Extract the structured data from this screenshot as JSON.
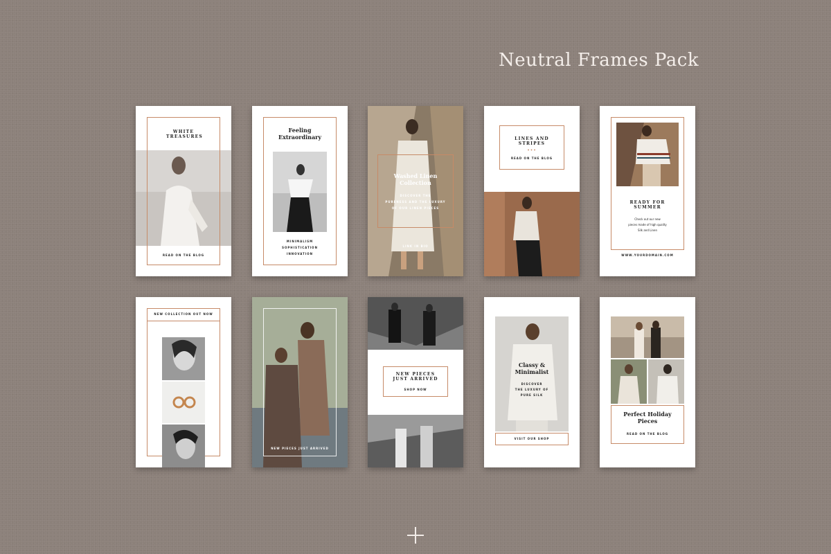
{
  "title": "Neutral Frames Pack",
  "cards": [
    {
      "title": "WHITE TREASURES",
      "cta": "READ ON THE BLOG"
    },
    {
      "title": "Feeling Extraordinary",
      "lines": [
        "MINIMALISM",
        "SOPHISTICATION",
        "INNOVATION"
      ]
    },
    {
      "title": "Washed Linen Collection",
      "lines": [
        "DISCOVER THE",
        "PURENESS AND THE LUXURY",
        "OF OUR LINEN PIECES"
      ],
      "cta": "LINK IN BIO"
    },
    {
      "title": "LINES AND STRIPES",
      "cta": "READ ON THE BLOG"
    },
    {
      "title": "READY FOR SUMMER",
      "lines": [
        "Check out our new",
        "pieces made of high quality",
        "Silk and Linen"
      ],
      "cta": "WWW.YOURDOMAIN.COM"
    },
    {
      "title": "NEW COLLECTION OUT NOW"
    },
    {
      "cta": "NEW PIECES JUST ARRIVED"
    },
    {
      "title": "NEW PIECES JUST ARRIVED",
      "cta": "SHOP NOW"
    },
    {
      "title": "Classy & Minimalist",
      "lines": [
        "DISCOVER",
        "THE LUXURY OF",
        "PURE SILK"
      ],
      "cta": "VISIT OUR SHOP"
    },
    {
      "title": "Perfect Holiday Pieces",
      "cta": "READ ON THE BLOG"
    }
  ],
  "colors": {
    "background": "#8c817a",
    "card": "#ffffff",
    "accent": "#c68a67"
  },
  "icons": {
    "bottom": "plus-icon"
  }
}
